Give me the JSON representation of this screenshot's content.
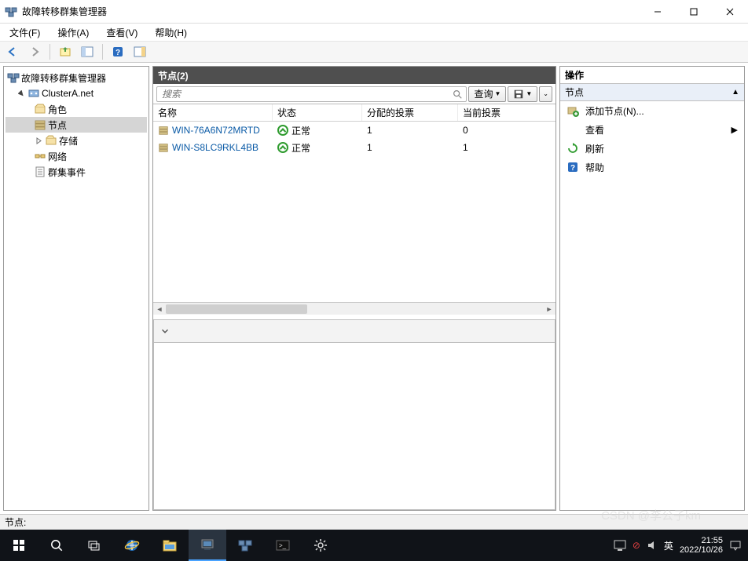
{
  "window": {
    "title": "故障转移群集管理器"
  },
  "menu": {
    "file": "文件(F)",
    "action": "操作(A)",
    "view": "查看(V)",
    "help": "帮助(H)"
  },
  "tree": {
    "root": "故障转移群集管理器",
    "cluster": "ClusterA.net",
    "roles": "角色",
    "nodes": "节点",
    "storage": "存储",
    "network": "网络",
    "events": "群集事件"
  },
  "center": {
    "heading": "节点(2)",
    "search_placeholder": "搜索",
    "query_btn": "查询",
    "cols": {
      "name": "名称",
      "state": "状态",
      "assigned": "分配的投票",
      "current": "当前投票"
    },
    "rows": [
      {
        "name": "WIN-76A6N72MRTD",
        "state": "正常",
        "assigned": "1",
        "current": "0"
      },
      {
        "name": "WIN-S8LC9RKL4BB",
        "state": "正常",
        "assigned": "1",
        "current": "1"
      }
    ]
  },
  "actions": {
    "heading": "操作",
    "section": "节点",
    "add_node": "添加节点(N)...",
    "view": "查看",
    "refresh": "刷新",
    "help": "帮助"
  },
  "status": {
    "label": "节点:"
  },
  "taskbar": {
    "ime": "英",
    "time": "21:55",
    "date": "2022/10/26",
    "watermark": "CSDN @李公子km"
  }
}
